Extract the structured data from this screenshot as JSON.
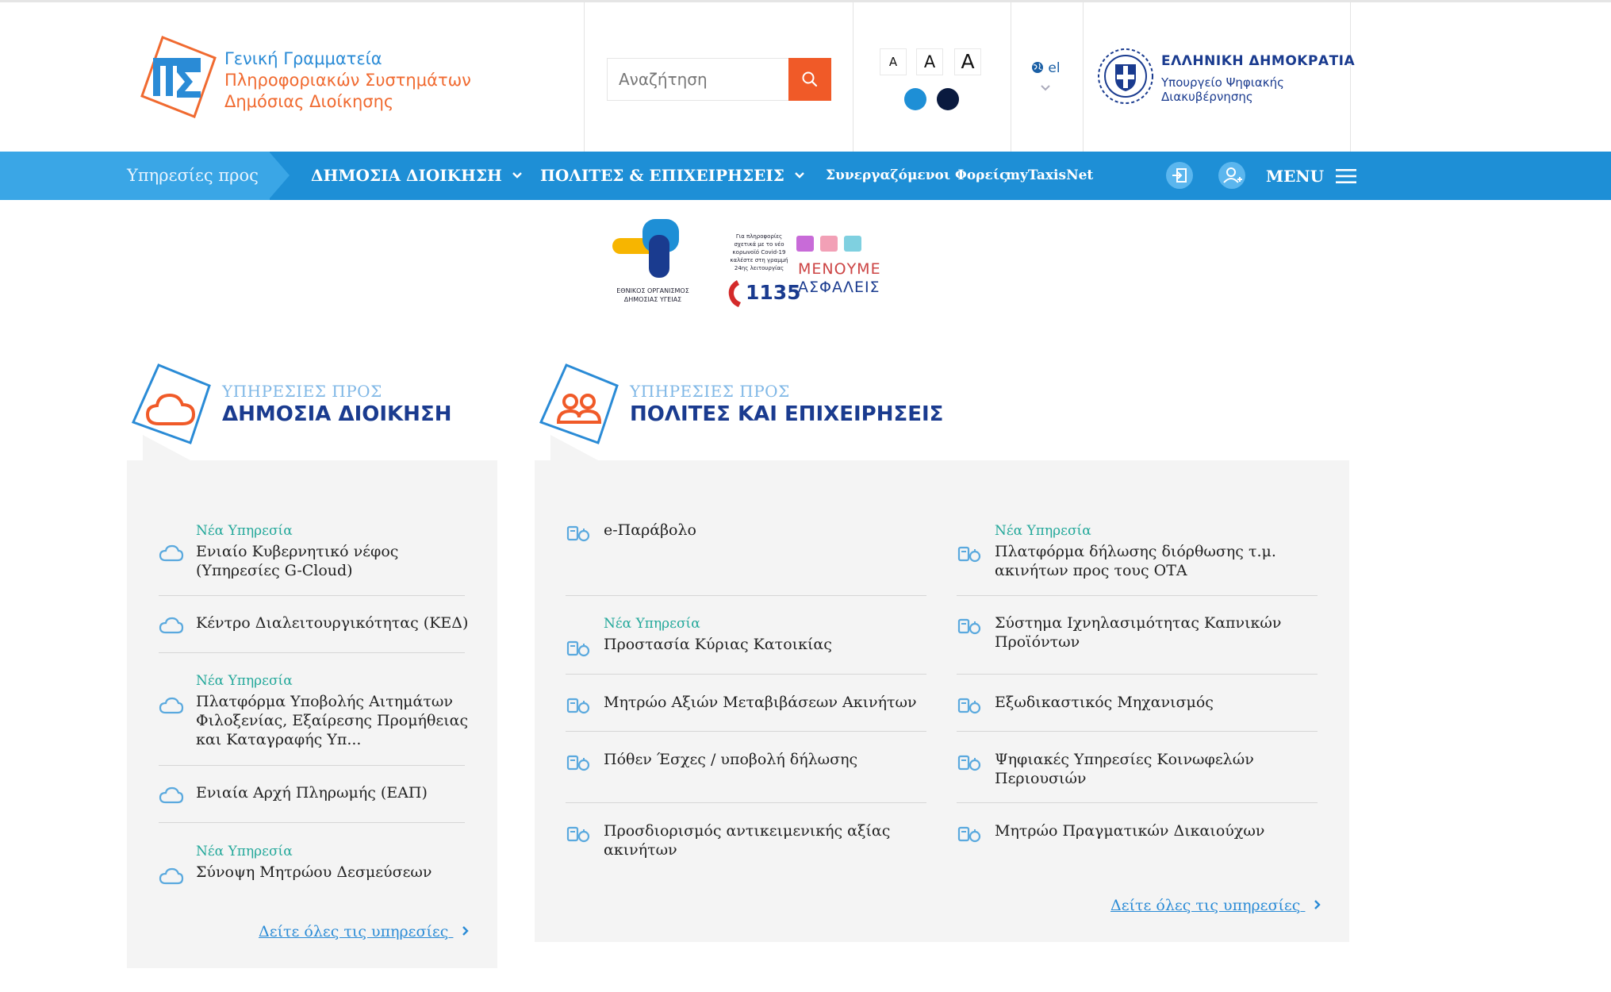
{
  "header": {
    "logo_line1": "Γενική Γραμματεία",
    "logo_line2": "Πληροφοριακών Συστημάτων",
    "logo_line3": "Δημόσιας Διοίκησης",
    "search_placeholder": "Αναζήτηση",
    "font_sizes": [
      "A",
      "A",
      "A"
    ],
    "contrast_colors": [
      "#1e8fd6",
      "#0a1a3f"
    ],
    "language": "el",
    "gov_title": "ΕΛΛΗΝΙΚΗ ΔΗΜΟΚΡΑΤΙΑ",
    "gov_sub1": "Υπουργείο Ψηφιακής",
    "gov_sub2": "Διακυβέρνησης"
  },
  "nav": {
    "intro": "Υπηρεσίες προς",
    "items": [
      "ΔΗΜΟΣΙΑ ΔΙΟΙΚΗΣΗ",
      "ΠΟΛΙΤΕΣ & ΕΠΙΧΕΙΡΗΣΕΙΣ",
      "Συνεργαζόμενοι Φορείς",
      "myTaxisNet"
    ],
    "menu": "MENU"
  },
  "banners": {
    "eody": "ΕΘΝΙΚΟΣ ΟΡΓΑΝΙΣΜΟΣ ΔΗΜΟΣΙΑΣ ΥΓΕΙΑΣ",
    "covid_info": "Για πληροφορίες σχετικά με το νέο κορωνοϊό Covid-19 καλέστε στη γραμμή 24ης λειτουργίας",
    "phone": "1135",
    "slogan1": "ΜΕΝΟΥΜΕ",
    "slogan2": "ΑΣΦΑΛΕΙΣ"
  },
  "sections": {
    "left": {
      "small": "ΥΠΗΡΕΣΙΕΣ ΠΡΟΣ",
      "title": "ΔΗΜΟΣΙΑ ΔΙΟΙΚΗΣΗ",
      "items": [
        {
          "badge": "Νέα Υπηρεσία",
          "text": "Ενιαίο Κυβερνητικό νέφος (Υπηρεσίες G-Cloud)"
        },
        {
          "badge": "",
          "text": "Κέντρο Διαλειτουργικότητας (ΚΕΔ)"
        },
        {
          "badge": "Νέα Υπηρεσία",
          "text": "Πλατφόρμα Υποβολής Αιτημάτων Φιλοξενίας, Εξαίρεσης Προμήθειας και Καταγραφής Υπ..."
        },
        {
          "badge": "",
          "text": "Ενιαία Αρχή Πληρωμής (ΕΑΠ)"
        },
        {
          "badge": "Νέα Υπηρεσία",
          "text": "Σύνοψη Μητρώου Δεσμεύσεων"
        }
      ],
      "see_all": "Δείτε όλες τις υπηρεσίες"
    },
    "right": {
      "small": "ΥΠΗΡΕΣΙΕΣ ΠΡΟΣ",
      "title": "ΠΟΛΙΤΕΣ ΚΑΙ ΕΠΙΧΕΙΡΗΣΕΙΣ",
      "col1": [
        {
          "badge": "",
          "text": "e-Παράβολο"
        },
        {
          "badge": "Νέα Υπηρεσία",
          "text": "Προστασία Κύριας Κατοικίας"
        },
        {
          "badge": "",
          "text": "Μητρώο Αξιών Μεταβιβάσεων Ακινήτων"
        },
        {
          "badge": "",
          "text": "Πόθεν Έσχες / υποβολή δήλωσης"
        },
        {
          "badge": "",
          "text": "Προσδιορισμός αντικειμενικής αξίας ακινήτων"
        }
      ],
      "col2": [
        {
          "badge": "Νέα Υπηρεσία",
          "text": "Πλατφόρμα δήλωσης διόρθωσης τ.μ. ακινήτων προς τους ΟΤΑ"
        },
        {
          "badge": "",
          "text": "Σύστημα Ιχνηλασιμότητας Καπνικών Προϊόντων"
        },
        {
          "badge": "",
          "text": "Εξωδικαστικός Μηχανισμός"
        },
        {
          "badge": "",
          "text": "Ψηφιακές Υπηρεσίες Κοινωφελών Περιουσιών"
        },
        {
          "badge": "",
          "text": "Μητρώο Πραγματικών Δικαιούχων"
        }
      ],
      "see_all": "Δείτε όλες τις υπηρεσίες"
    }
  }
}
